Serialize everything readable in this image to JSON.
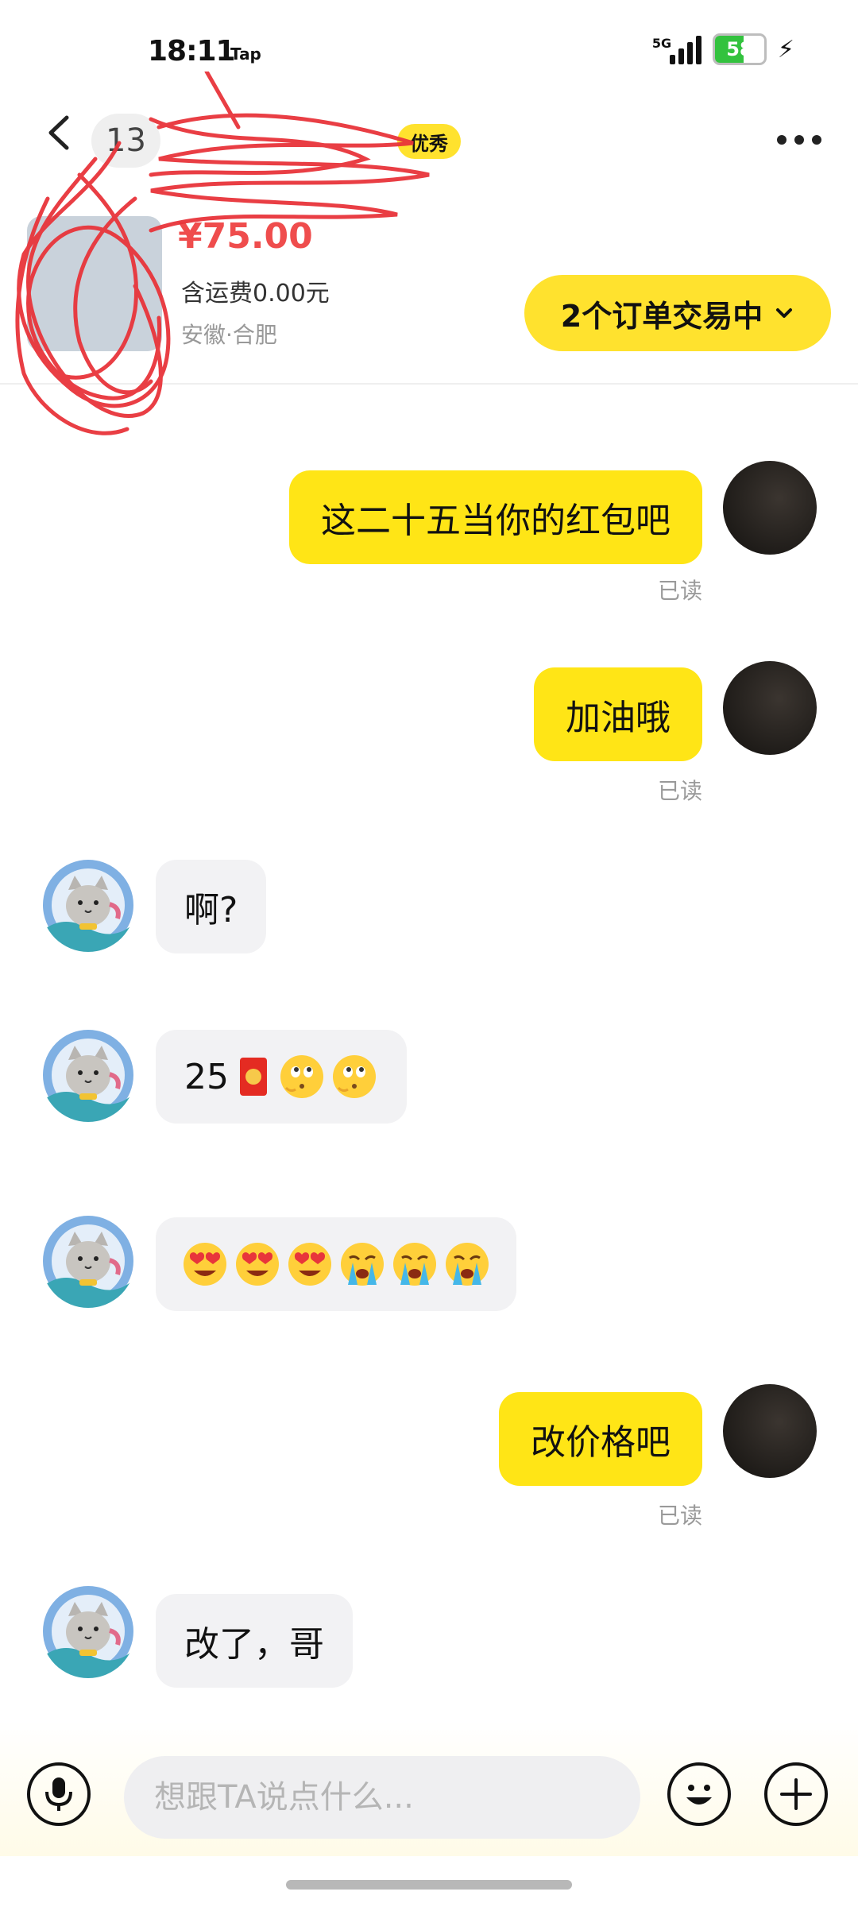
{
  "status_bar": {
    "time": "18:11",
    "tap": "Tap",
    "network": "5G",
    "battery": "58",
    "battery_level": 0.58
  },
  "header": {
    "title_prefix": "13",
    "badge_suffix": "优秀"
  },
  "product": {
    "price": "¥75.00",
    "shipping": "含运费0.00元",
    "location": "安徽·合肥"
  },
  "orders_button": {
    "label": "2个订单交易中"
  },
  "messages": [
    {
      "side": "right",
      "text": "这二十五当你的红包吧",
      "status": "已读"
    },
    {
      "side": "right",
      "text": "加油哦",
      "status": "已读"
    },
    {
      "side": "left",
      "text": "啊?"
    },
    {
      "side": "left",
      "text": "25"
    },
    {
      "side": "left",
      "text": ""
    },
    {
      "side": "right",
      "text": "改价格吧",
      "status": "已读"
    },
    {
      "side": "left",
      "text": "改了，哥"
    }
  ],
  "input": {
    "placeholder": "想跟TA说点什么..."
  },
  "colors": {
    "accent": "#ffe22e",
    "bubble_mine": "#ffe516",
    "bubble_theirs": "#f2f2f4",
    "price": "#ef4d4d",
    "read": "#9a9a9a"
  }
}
